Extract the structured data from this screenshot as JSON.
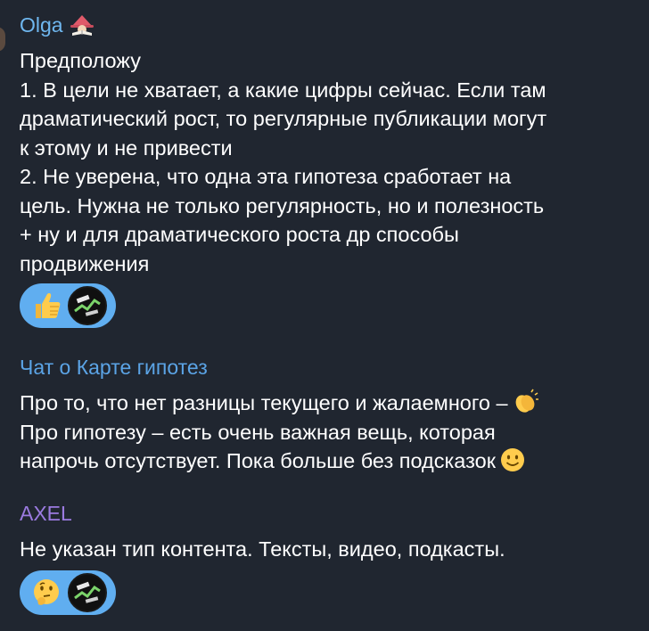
{
  "messages": [
    {
      "sender": "Olga",
      "sender_color": "#6fb7ef",
      "sender_icon": "reading-witch-emoji",
      "lines": [
        "Предположу",
        "1. В цели не хватает, а какие цифры сейчас. Если там",
        "драматический рост, то регулярные публикации могут",
        "к этому и не привести",
        "2. Не уверена, что одна эта гипотеза сработает на",
        "цель. Нужна не только регулярность, но и полезность",
        "+ ну и для драматического роста др способы",
        "продвижения"
      ],
      "reaction_emoji": "thumbs-up-emoji"
    },
    {
      "sender": "Чат о Карте гипотез",
      "sender_color": "#5ba4e6",
      "line1": "Про то, что нет разницы текущего и жалаемного –",
      "line1_emoji": "clapping-hands-emoji",
      "line2": "Про гипотезу – есть очень важная вещь, которая",
      "line3": "напрочь отсутствует. Пока больше без подсказок",
      "line3_emoji": "smiling-face-emoji"
    },
    {
      "sender": "AXEL",
      "sender_color": "#9b7be0",
      "lines": [
        "Не указан тип контента. Тексты, видео, подкасты."
      ],
      "reaction_emoji": "thinking-face-emoji"
    }
  ],
  "colors": {
    "background": "#202630",
    "reaction_pill": "#60aef0",
    "text": "#ffffff"
  }
}
